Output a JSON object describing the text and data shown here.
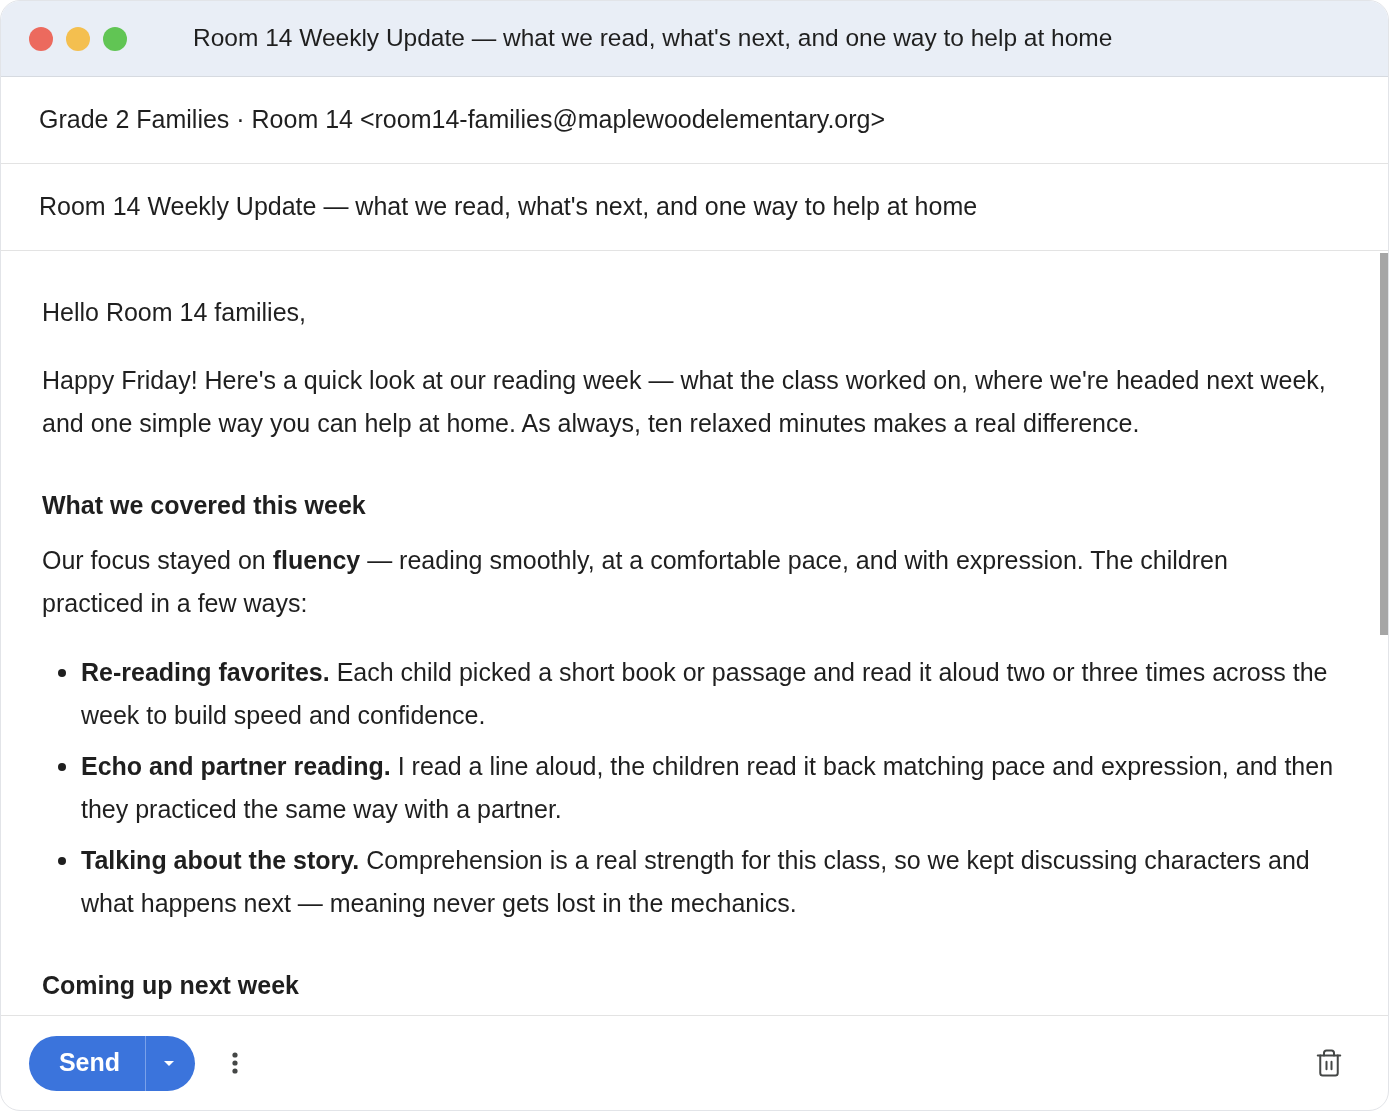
{
  "window": {
    "title": "Room 14 Weekly Update — what we read, what's next, and one way to help at home"
  },
  "recipients": {
    "value": "Grade 2 Families · Room 14 <room14-families@maplewoodelementary.org>"
  },
  "subject": {
    "value": "Room 14 Weekly Update — what we read, what's next, and one way to help at home"
  },
  "body": {
    "blocks": [
      {
        "kind": "paragraph",
        "text": "Hello Room 14 families,"
      },
      {
        "kind": "paragraph",
        "text": "Happy Friday! Here's a quick look at our reading week — what the class worked on, where we're headed next week, and one simple way you can help at home. As always, ten relaxed minutes makes a real difference."
      },
      {
        "kind": "heading",
        "text": "What we covered this week"
      },
      {
        "kind": "paragraph",
        "text": "Our focus stayed on **fluency** — reading smoothly, at a comfortable pace, and with expression. The children practiced in a few ways:"
      },
      {
        "kind": "list",
        "items": [
          "**Re-reading favorites.** Each child picked a short book or passage and read it aloud two or three times across the week to build speed and confidence.",
          "**Echo and partner reading.** I read a line aloud, the children read it back matching pace and expression, and then they practiced the same way with a partner.",
          "**Talking about the story.** Comprehension is a real strength for this class, so we kept discussing characters and what happens next — meaning never gets lost in the mechanics."
        ]
      },
      {
        "kind": "heading",
        "text": "Coming up next week"
      }
    ]
  },
  "footer": {
    "send": {
      "label": "Send"
    }
  }
}
